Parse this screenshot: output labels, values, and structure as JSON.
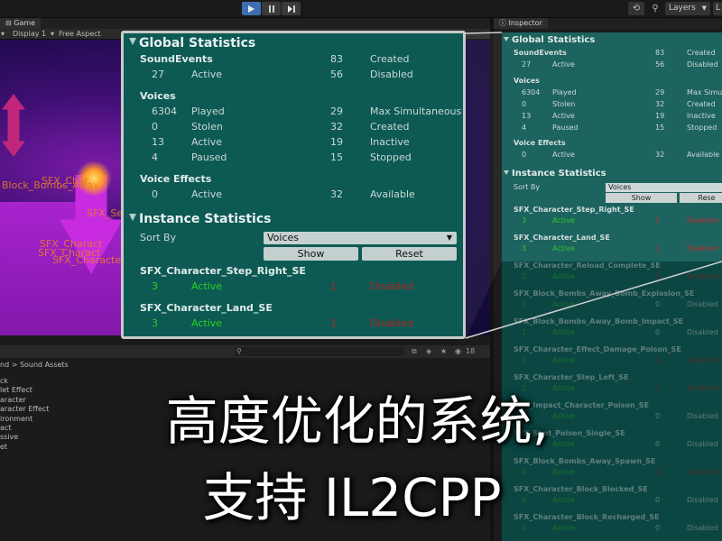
{
  "toolbar": {
    "layers_label": "Layers",
    "layout_label": "L"
  },
  "game": {
    "tab_label": "Game",
    "display_label": "Display 1",
    "aspect_label": "Free Aspect",
    "labels": [
      "SFX_Char",
      "Block_Bombs_Away",
      "SFX_Se",
      "SFX_Charact",
      "SFX_Charact",
      "SFX_Characte"
    ]
  },
  "project": {
    "breadcrumb": "nd > Sound Assets",
    "tree": [
      "ck",
      "let Effect",
      "aracter",
      "aracter Effect",
      "ironment",
      "act",
      "ssive",
      "et"
    ],
    "hidden_count": "18"
  },
  "inspector": {
    "tab_label": "Inspector",
    "global_title": "Global Statistics",
    "sound_events_label": "SoundEvents",
    "se_created_value": "83",
    "se_created_label": "Created",
    "se_active_value": "27",
    "se_active_label": "Active",
    "se_disabled_value": "56",
    "se_disabled_label": "Disabled",
    "voices_label": "Voices",
    "v_played_value": "6304",
    "v_played_label": "Played",
    "v_maxsim_value": "29",
    "v_maxsim_label": "Max Simul",
    "v_stolen_value": "0",
    "v_stolen_label": "Stolen",
    "v_created_value": "32",
    "v_created_label": "Created",
    "v_active_value": "13",
    "v_active_label": "Active",
    "v_inactive_value": "19",
    "v_inactive_label": "Inactive",
    "v_paused_value": "4",
    "v_paused_label": "Paused",
    "v_stopped_value": "15",
    "v_stopped_label": "Stopped",
    "ve_label": "Voice Effects",
    "ve_active_value": "0",
    "ve_active_label": "Active",
    "ve_available_value": "32",
    "ve_available_label": "Available",
    "instance_title": "Instance Statistics",
    "sort_by_label": "Sort By",
    "sort_by_value": "Voices",
    "show_button": "Show",
    "reset_button": "Rese",
    "items": [
      {
        "name": "SFX_Character_Step_Right_SE",
        "count": "3",
        "status": "Active",
        "right_value": "1",
        "right_label": "Disabled",
        "faded": false
      },
      {
        "name": "SFX_Character_Land_SE",
        "count": "3",
        "status": "Active",
        "right_value": "1",
        "right_label": "Disabled",
        "faded": false
      },
      {
        "name": "SFX_Character_Reload_Complete_SE",
        "count": "2",
        "status": "Active",
        "right_value": "1",
        "right_label": "Disabled",
        "faded": true
      },
      {
        "name": "SFX_Block_Bombs_Away_Bomb_Explosion_SE",
        "count": "1",
        "status": "Active",
        "right_value": "0",
        "right_label": "Disabled",
        "faded": true
      },
      {
        "name": "SFX_Block_Bombs_Away_Bomb_Impact_SE",
        "count": "1",
        "status": "Active",
        "right_value": "0",
        "right_label": "Disabled",
        "faded": true
      },
      {
        "name": "SFX_Character_Effect_Damage_Poison_SE",
        "count": "1",
        "status": "Active",
        "right_value": "1",
        "right_label": "Disabled",
        "faded": true
      },
      {
        "name": "SFX_Character_Step_Left_SE",
        "count": "2",
        "status": "Active",
        "right_value": "1",
        "right_label": "Disabled",
        "faded": true
      },
      {
        "name": "SFX_Impact_Character_Poison_SE",
        "count": "1",
        "status": "Active",
        "right_value": "0",
        "right_label": "Disabled",
        "faded": true
      },
      {
        "name": "SFX_Shot_Poison_Single_SE",
        "count": "1",
        "status": "Active",
        "right_value": "0",
        "right_label": "Disabled",
        "faded": true
      },
      {
        "name": "SFX_Block_Bombs_Away_Spawn_SE",
        "count": "0",
        "status": "Active",
        "right_value": "1",
        "right_label": "Disabled",
        "faded": true
      },
      {
        "name": "SFX_Character_Block_Blocked_SE",
        "count": "4",
        "status": "Active",
        "right_value": "0",
        "right_label": "Disabled",
        "faded": true
      },
      {
        "name": "SFX_Character_Block_Recharged_SE",
        "count": "0",
        "status": "Active",
        "right_value": "0",
        "right_label": "Disabled",
        "faded": true
      }
    ]
  },
  "zoom": {
    "global_title": "Global Statistics",
    "sound_events_label": "SoundEvents",
    "se_created_value": "83",
    "se_created_label": "Created",
    "se_active_value": "27",
    "se_active_label": "Active",
    "se_disabled_value": "56",
    "se_disabled_label": "Disabled",
    "voices_label": "Voices",
    "v_played_value": "6304",
    "v_played_label": "Played",
    "v_maxsim_value": "29",
    "v_maxsim_label": "Max Simultaneous",
    "v_stolen_value": "0",
    "v_stolen_label": "Stolen",
    "v_created_value": "32",
    "v_created_label": "Created",
    "v_active_value": "13",
    "v_active_label": "Active",
    "v_inactive_value": "19",
    "v_inactive_label": "Inactive",
    "v_paused_value": "4",
    "v_paused_label": "Paused",
    "v_stopped_value": "15",
    "v_stopped_label": "Stopped",
    "ve_label": "Voice Effects",
    "ve_active_value": "0",
    "ve_active_label": "Active",
    "ve_available_value": "32",
    "ve_available_label": "Available",
    "instance_title": "Instance Statistics",
    "sort_by_label": "Sort By",
    "sort_by_value": "Voices",
    "show_button": "Show",
    "reset_button": "Reset",
    "item1_name": "SFX_Character_Step_Right_SE",
    "item1_count": "3",
    "item1_status": "Active",
    "item1_right_value": "1",
    "item1_right_label": "Disabled",
    "item2_name": "SFX_Character_Land_SE",
    "item2_count": "3",
    "item2_status": "Active",
    "item2_right_value": "1",
    "item2_right_label": "Disabled"
  },
  "caption": {
    "line1": "高度优化的系统,",
    "line2": "支持 IL2CPP"
  },
  "colors": {
    "panel_teal": "#0d5a54",
    "active_green": "#28d11a",
    "disabled_red": "#b42220"
  }
}
